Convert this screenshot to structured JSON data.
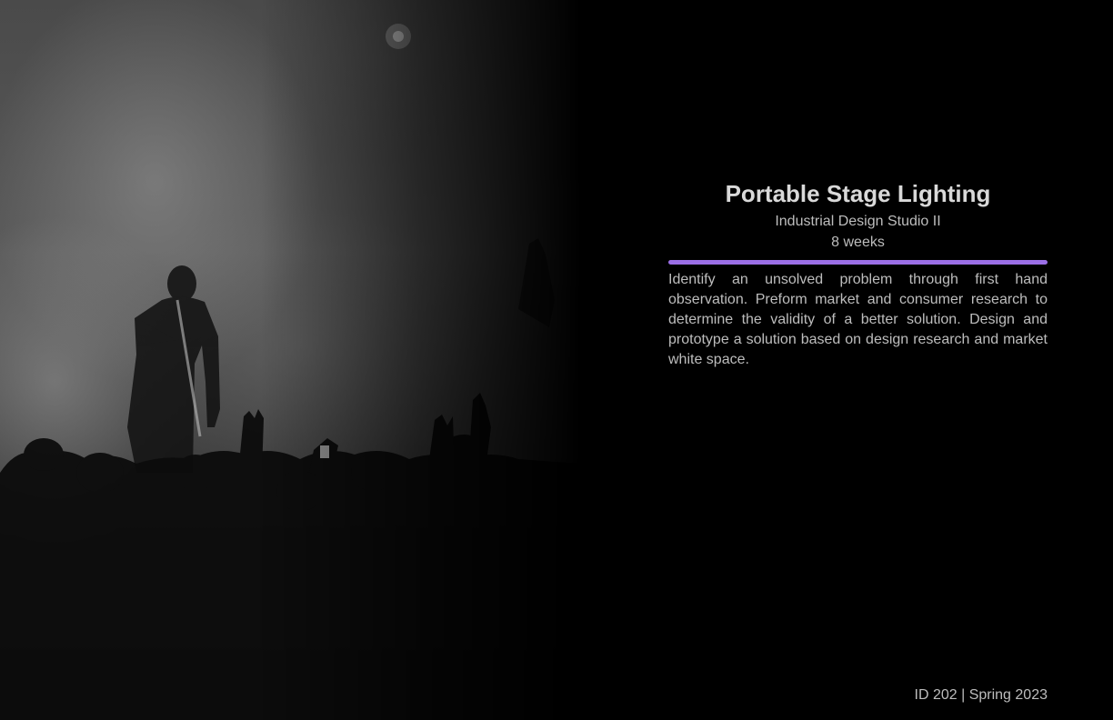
{
  "hero_image": {
    "subject": "performer on smoky stage with crowd hands raised"
  },
  "project": {
    "title": "Portable Stage Lighting",
    "course": "Industrial Design Studio II",
    "duration": "8 weeks",
    "description": "Identify an unsolved problem through first hand observation. Preform market and consumer research to determine the validity of a better solution. Design and prototype a solution based on design research and market white space."
  },
  "footer": {
    "course_term": "ID 202 | Spring 2023"
  },
  "colors": {
    "accent": "#9b6fe6",
    "background": "#000000",
    "text": "#bdbdbd"
  }
}
